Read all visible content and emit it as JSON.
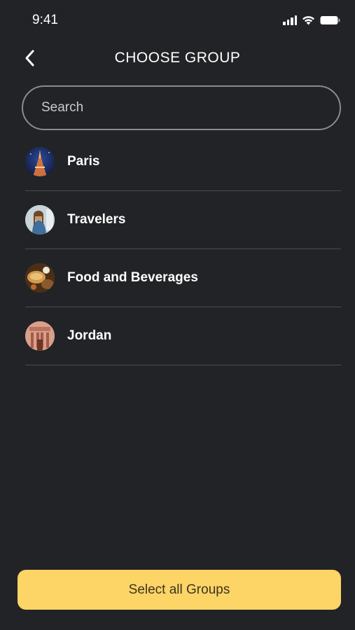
{
  "status_bar": {
    "time": "9:41"
  },
  "header": {
    "title": "CHOOSE GROUP",
    "back_icon": "chevron-left-icon"
  },
  "search": {
    "placeholder": "Search",
    "value": ""
  },
  "groups": [
    {
      "name": "Paris",
      "avatar": "paris-avatar"
    },
    {
      "name": "Travelers",
      "avatar": "travelers-avatar"
    },
    {
      "name": "Food and Beverages",
      "avatar": "food-avatar"
    },
    {
      "name": "Jordan",
      "avatar": "jordan-avatar"
    }
  ],
  "footer": {
    "select_all_label": "Select all Groups"
  },
  "colors": {
    "background": "#222326",
    "accent": "#fdd466",
    "divider": "#4a4b4e",
    "search_border": "#8a8b8e"
  }
}
